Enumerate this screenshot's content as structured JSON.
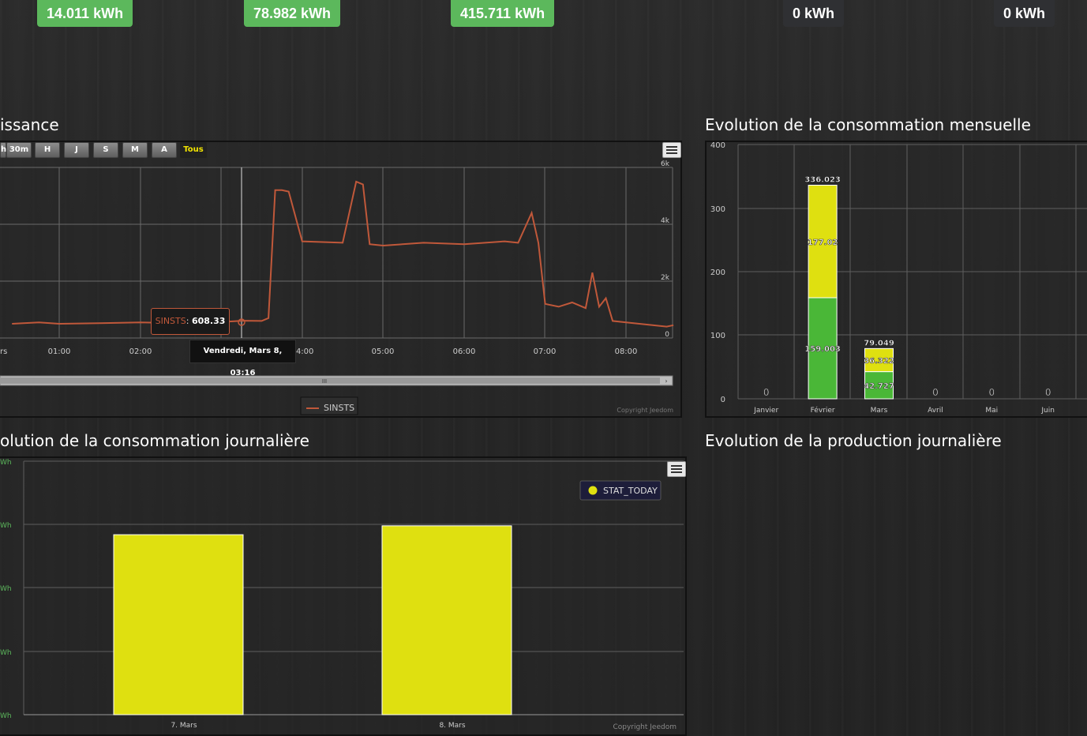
{
  "summary": {
    "badges": [
      "14.011 kWh",
      "78.982 kWh",
      "415.711 kWh",
      "0 kWh",
      "0 kWh"
    ]
  },
  "puissance": {
    "title": "issance",
    "range_buttons": [
      "h",
      "30m",
      "H",
      "J",
      "S",
      "M",
      "A",
      "Tous"
    ],
    "active_range": "Tous",
    "y_ticks": [
      "6k",
      "4k",
      "2k",
      "0"
    ],
    "x_ticks": [
      "rs",
      "01:00",
      "02:00",
      "",
      "04:00",
      "05:00",
      "06:00",
      "07:00",
      "08:00"
    ],
    "tooltip_series": "SINSTS",
    "tooltip_value": "608.33",
    "tooltip_date": "Vendredi, Mars 8, 03:16",
    "legend": "SINSTS",
    "copyright": "Copyright Jeedom",
    "scroll_grip": "III",
    "series_color": "#c0583a"
  },
  "mensuelle": {
    "title": "Evolution de la consommation mensuelle",
    "y_ticks": [
      "400",
      "300",
      "200",
      "100",
      "0"
    ]
  },
  "journaliere": {
    "title": "olution de la consommation journalière",
    "y_ticks": [
      "Wh",
      "Wh",
      "Wh",
      "Wh",
      "Wh"
    ],
    "legend": "STAT_TODAY",
    "copyright": "Copyright Jeedom"
  },
  "production": {
    "title": "Evolution de la production journalière"
  },
  "chart_data": [
    {
      "type": "line",
      "series": [
        {
          "name": "SINSTS",
          "x": [
            "00:25",
            "00:45",
            "01:00",
            "01:30",
            "02:00",
            "02:30",
            "03:00",
            "03:16",
            "03:30",
            "03:35",
            "03:40",
            "03:45",
            "03:50",
            "04:00",
            "04:30",
            "04:40",
            "04:45",
            "04:50",
            "05:00",
            "05:30",
            "06:00",
            "06:30",
            "06:40",
            "06:50",
            "06:55",
            "07:00",
            "07:10",
            "07:20",
            "07:30",
            "07:35",
            "07:40",
            "07:45",
            "07:50",
            "08:00",
            "08:30",
            "08:35"
          ],
          "values": [
            500,
            550,
            500,
            520,
            550,
            520,
            560,
            608,
            600,
            700,
            5200,
            5200,
            5150,
            3400,
            3350,
            5500,
            5400,
            3300,
            3250,
            3350,
            3300,
            3400,
            3350,
            4400,
            3350,
            1200,
            1100,
            1250,
            1050,
            2300,
            1100,
            1400,
            600,
            550,
            400,
            450
          ]
        }
      ],
      "ylim": [
        0,
        6000
      ]
    },
    {
      "type": "bar",
      "categories": [
        "Janvier",
        "Février",
        "Mars",
        "Avril",
        "Mai",
        "Juin"
      ],
      "series": [
        {
          "values": [
            0,
            159.003,
            42.727,
            0,
            0,
            0
          ]
        },
        {
          "values": [
            0,
            177.02,
            36.322,
            0,
            0,
            0
          ]
        }
      ],
      "totals": [
        0,
        336.023,
        79.049,
        0,
        0,
        0
      ],
      "ylim": [
        0,
        400
      ]
    },
    {
      "type": "bar",
      "categories": [
        "7. Mars",
        "8. Mars"
      ],
      "series": [
        {
          "name": "STAT_TODAY",
          "values": [
            14.2,
            14.9
          ]
        }
      ],
      "ylim": [
        0,
        20
      ]
    }
  ]
}
